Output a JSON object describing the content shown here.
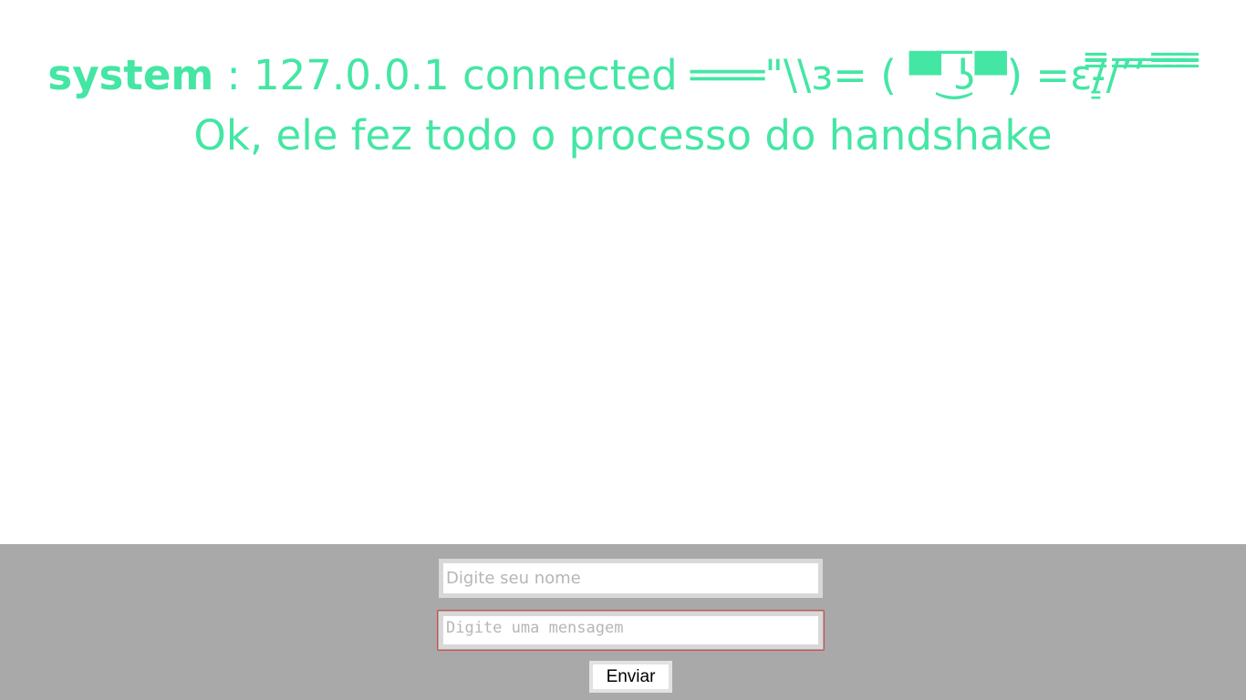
{
  "colors": {
    "accent": "#44e6a4",
    "footer_bg": "#a9a9a9",
    "field_border": "#d8d8d8",
    "focus_border": "#d84a4a"
  },
  "chat": {
    "messages": [
      {
        "user": "system",
        "separator": " : ",
        "text": "127.0.0.1 connected ═══\"\\\\з= ( ▀ ͜͞ʖ▀) =ε/̵͇̿̿/’̿’̿ ̿ ̿̿ ̿̿ ̿̿ Ok, ele fez todo o processo do handshake"
      }
    ]
  },
  "form": {
    "name_input": {
      "placeholder": "Digite seu nome",
      "value": ""
    },
    "message_input": {
      "placeholder": "Digite uma mensagem",
      "value": ""
    },
    "send_label": "Enviar"
  }
}
